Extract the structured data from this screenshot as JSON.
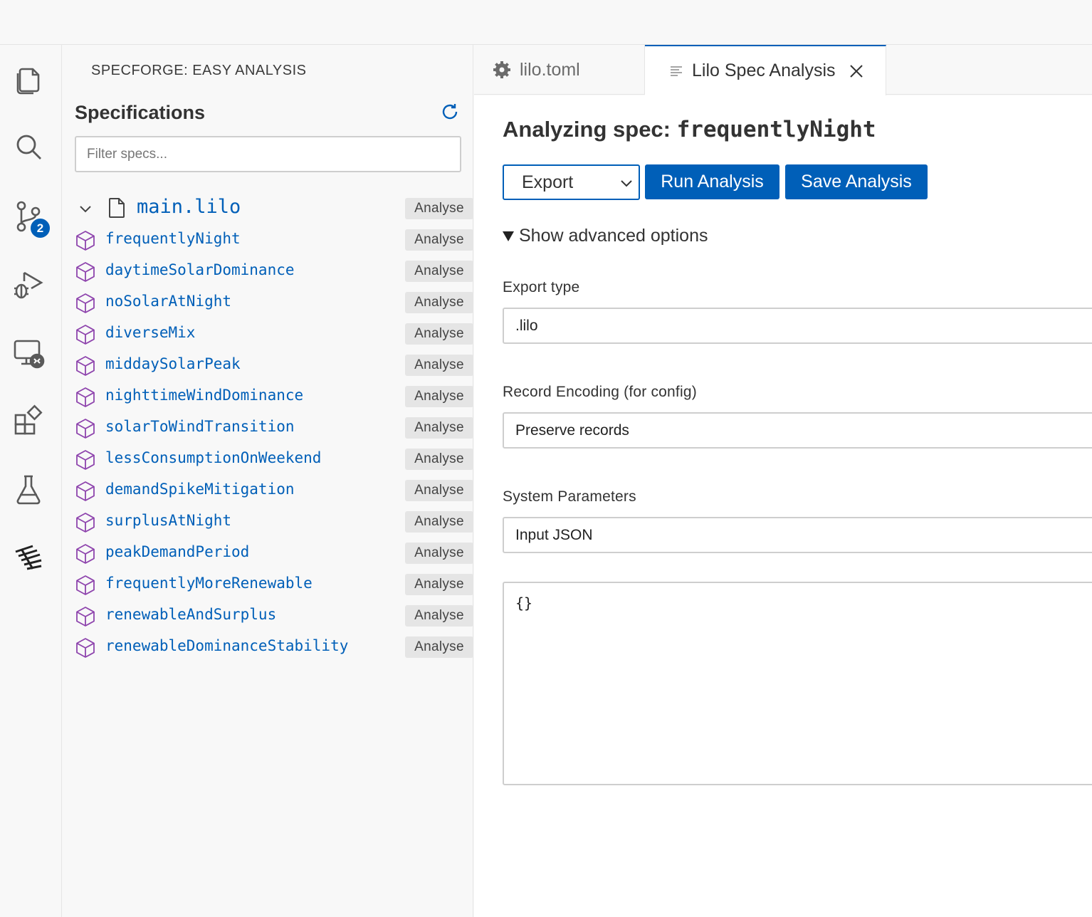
{
  "activity_bar": {
    "icons": [
      "explorer-icon",
      "search-icon",
      "source-control-icon",
      "run-debug-icon",
      "remote-explorer-icon",
      "extensions-icon",
      "testing-icon",
      "specforge-icon"
    ],
    "source_control_badge": "2"
  },
  "sidebar": {
    "title": "SPECFORGE: EASY ANALYSIS",
    "heading": "Specifications",
    "filter_placeholder": "Filter specs...",
    "file": {
      "name": "main.lilo",
      "action": "Analyse"
    },
    "specs": [
      {
        "name": "frequentlyNight",
        "action": "Analyse"
      },
      {
        "name": "daytimeSolarDominance",
        "action": "Analyse"
      },
      {
        "name": "noSolarAtNight",
        "action": "Analyse"
      },
      {
        "name": "diverseMix",
        "action": "Analyse"
      },
      {
        "name": "middaySolarPeak",
        "action": "Analyse"
      },
      {
        "name": "nighttimeWindDominance",
        "action": "Analyse"
      },
      {
        "name": "solarToWindTransition",
        "action": "Analyse"
      },
      {
        "name": "lessConsumptionOnWeekend",
        "action": "Analyse"
      },
      {
        "name": "demandSpikeMitigation",
        "action": "Analyse"
      },
      {
        "name": "surplusAtNight",
        "action": "Analyse"
      },
      {
        "name": "peakDemandPeriod",
        "action": "Analyse"
      },
      {
        "name": "frequentlyMoreRenewable",
        "action": "Analyse"
      },
      {
        "name": "renewableAndSurplus",
        "action": "Analyse"
      },
      {
        "name": "renewableDominanceStability",
        "action": "Analyse"
      }
    ]
  },
  "tabs": [
    {
      "label": "lilo.toml",
      "icon": "gear-icon"
    },
    {
      "label": "Lilo Spec Analysis",
      "icon": "preview-icon",
      "active": true
    }
  ],
  "editor": {
    "heading_prefix": "Analyzing spec: ",
    "heading_spec": "frequentlyNight",
    "mode_select": "Export",
    "run_button": "Run Analysis",
    "save_button": "Save Analysis",
    "advanced_toggle": "Show advanced options",
    "export_type_label": "Export type",
    "export_type_value": ".lilo",
    "record_encoding_label": "Record Encoding (for config)",
    "record_encoding_value": "Preserve records",
    "system_params_label": "System Parameters",
    "system_params_value": "Input JSON",
    "json_text": "{}"
  },
  "colors": {
    "accent": "#005fb8",
    "spec_icon": "#8e44ad",
    "link_text": "#005fb8"
  }
}
